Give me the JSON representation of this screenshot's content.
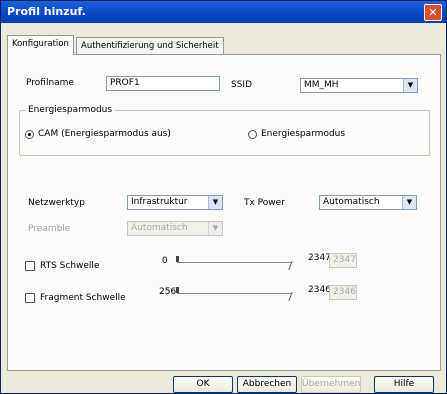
{
  "window": {
    "title": "Profil hinzuf.",
    "close_glyph": "✕"
  },
  "tabs": [
    {
      "label": "Konfiguration",
      "active": true
    },
    {
      "label": "Authentifizierung und Sicherheit",
      "active": false
    }
  ],
  "profile": {
    "name_label": "Profilname",
    "name_value": "PROF1",
    "ssid_label": "SSID",
    "ssid_value": "MM_MH"
  },
  "power_mode": {
    "group_label": "Energiesparmodus",
    "options": [
      {
        "label": "CAM (Energiesparmodus aus)",
        "selected": true
      },
      {
        "label": "Energiesparmodus",
        "selected": false
      }
    ]
  },
  "network": {
    "type_label": "Netzwerktyp",
    "type_value": "Infrastruktur",
    "txpower_label": "Tx Power",
    "txpower_value": "Automatisch",
    "preamble_label": "Preamble",
    "preamble_value": "Automatisch"
  },
  "rts": {
    "label": "RTS Schwelle",
    "checked": false,
    "min": "0",
    "max": "2347",
    "value": "2347"
  },
  "fragment": {
    "label": "Fragment Schwelle",
    "checked": false,
    "min": "256",
    "max": "2346",
    "value": "2346"
  },
  "buttons": {
    "ok": "OK",
    "cancel": "Abbrechen",
    "apply": "Übernehmen",
    "help": "Hilfe"
  },
  "icons": {
    "dropdown_arrow": "▼"
  }
}
